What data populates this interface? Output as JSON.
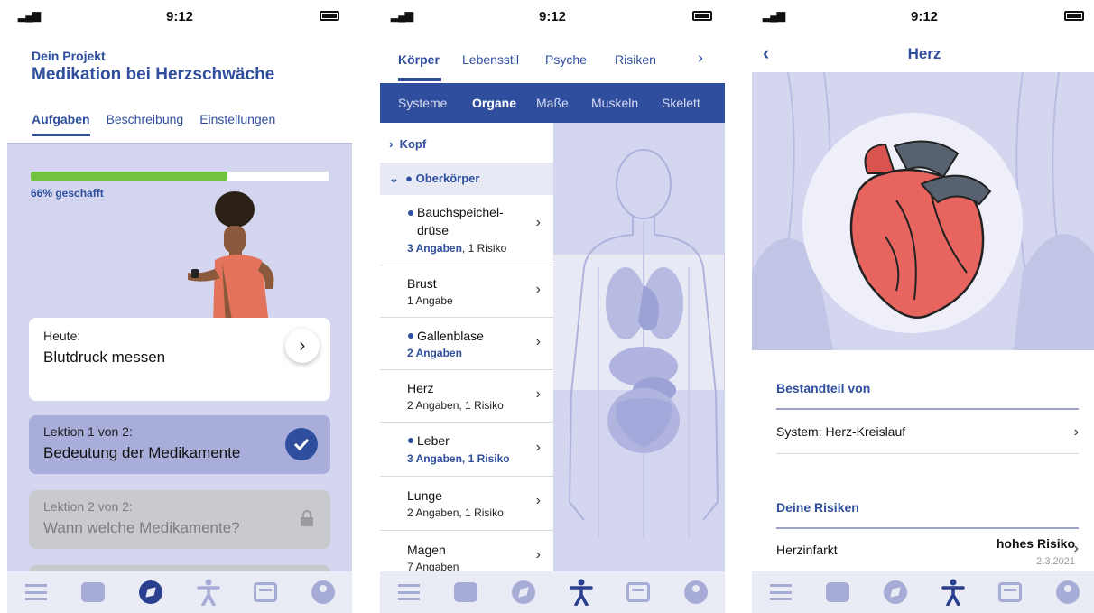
{
  "status_bar": {
    "time": "9:12"
  },
  "screen1": {
    "project_label": "Dein Projekt",
    "project_title": "Medikation bei Herzschwäche",
    "tabs": [
      {
        "label": "Aufgaben",
        "active": true
      },
      {
        "label": "Beschreibung",
        "active": false
      },
      {
        "label": "Einstellungen",
        "active": false
      }
    ],
    "progress": {
      "fraction": 0.66,
      "label": "66% geschafft"
    },
    "today_card": {
      "small": "Heute:",
      "big": "Blutdruck messen"
    },
    "lessons": [
      {
        "small": "Lektion 1 von 2:",
        "big": "Bedeutung der Medikamente",
        "state": "done"
      },
      {
        "small": "Lektion 2 von 2:",
        "big": "Wann welche Medikamente?",
        "state": "locked"
      }
    ]
  },
  "screen2": {
    "top_tabs": [
      "Körper",
      "Lebensstil",
      "Psyche",
      "Risiken"
    ],
    "top_tab_active": "Körper",
    "sub_tabs": [
      "Systeme",
      "Organe",
      "Maße",
      "Muskeln",
      "Skelett"
    ],
    "sub_tab_active": "Organe",
    "sections": [
      {
        "label": "Kopf",
        "expanded": false
      },
      {
        "label": "Oberkörper",
        "expanded": true
      }
    ],
    "organs": [
      {
        "name_line1": "Bauchspeichel-",
        "name_line2": "drüse",
        "meta_bold": "3 Angaben",
        "meta_rest": ", 1 Risiko",
        "flag": true
      },
      {
        "name_line1": "Brust",
        "meta_bold": "",
        "meta_rest": "1 Angabe",
        "flag": false
      },
      {
        "name_line1": "Gallenblase",
        "meta_bold": "2 Angaben",
        "meta_rest": "",
        "flag": true
      },
      {
        "name_line1": "Herz",
        "meta_bold": "",
        "meta_rest": "2 Angaben, 1 Risiko",
        "flag": false
      },
      {
        "name_line1": "Leber",
        "meta_bold": "3 Angaben, 1 Risiko",
        "meta_rest": "",
        "flag": true
      },
      {
        "name_line1": "Lunge",
        "meta_bold": "",
        "meta_rest": "2 Angaben, 1 Risiko",
        "flag": false
      },
      {
        "name_line1": "Magen",
        "meta_bold": "",
        "meta_rest": "7 Angaben",
        "flag": false
      }
    ]
  },
  "screen3": {
    "title": "Herz",
    "part_of_heading": "Bestandteil von",
    "part_of_row": "System: Herz-Kreislauf",
    "risks_heading": "Deine Risiken",
    "risk_row": {
      "name": "Herzinfarkt",
      "level": "hohes Risiko",
      "date": "2.3.2021"
    }
  },
  "tabbar": {
    "icons": [
      "menu-icon",
      "chat-icon",
      "compass-icon",
      "body-icon",
      "inbox-icon",
      "profile-icon"
    ],
    "active_screen1": "compass-icon",
    "active_screen2": "body-icon",
    "active_screen3": "body-icon"
  },
  "colors": {
    "accent": "#2f4f9e",
    "progress": "#71c23f",
    "pale": "#d3d6ee",
    "heart": "#e8655f"
  }
}
